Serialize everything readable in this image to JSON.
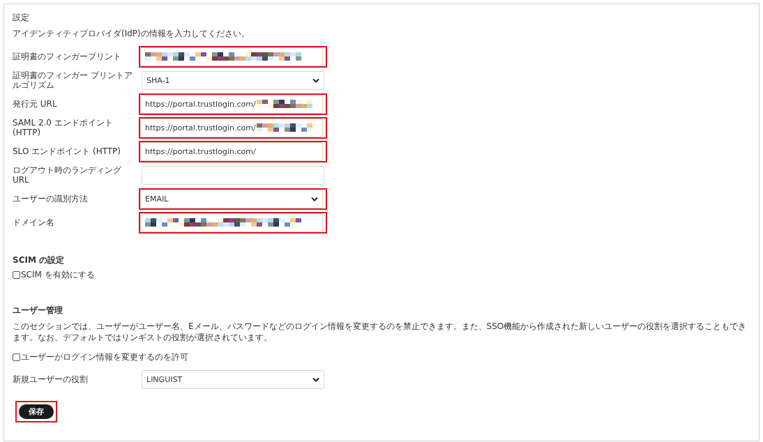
{
  "title": "設定",
  "intro": "アイデンティティプロバイダ(IdP)の情報を入力してください。",
  "fields": [
    {
      "label": "証明書のフィンガープリント",
      "kind": "text",
      "redacted": true,
      "highlighted": true
    },
    {
      "label": "証明書のフィンガー プリントアルゴリズム",
      "kind": "select",
      "value": "SHA-1",
      "redacted": false,
      "highlighted": false
    },
    {
      "label": "発行元 URL",
      "kind": "text",
      "value": "https://portal.trustlogin.com/",
      "redacted": true,
      "highlighted": true
    },
    {
      "label": "SAML 2.0 エンドポイント (HTTP)",
      "kind": "text",
      "value": "https://portal.trustlogin.com/",
      "redacted": true,
      "highlighted": true
    },
    {
      "label": "SLO エンドポイント (HTTP)",
      "kind": "text",
      "value": "https://portal.trustlogin.com/",
      "redacted": false,
      "highlighted": true
    },
    {
      "label": "ログアウト時のランディング URL",
      "kind": "text",
      "redacted": false,
      "highlighted": false
    },
    {
      "label": "ユーザーの識別方法",
      "kind": "select",
      "value": "EMAIL",
      "redacted": false,
      "highlighted": true
    },
    {
      "label": "ドメイン名",
      "kind": "text",
      "redacted": true,
      "highlighted": true
    }
  ],
  "scim": {
    "heading": "SCIM の設定",
    "checkbox": {
      "label": "SCIM を有効にする",
      "checked": false
    }
  },
  "user_management": {
    "heading": "ユーザー管理",
    "description": "このセクションでは、ユーザーがユーザー名、Eメール、パスワードなどのログイン情報を変更するのを禁止できます。また、SSO機能から作成された新しいユーザーの役割を選択することもできます。なお、デフォルトではリンギストの役割が選択されています。",
    "checkbox": {
      "label": "ユーザーがログイン情報を変更するのを許可",
      "checked": false
    },
    "role": {
      "label": "新規ユーザーの役割",
      "kind": "select",
      "value": "LINGUIST",
      "redacted": false,
      "highlighted": false
    }
  },
  "save_button": {
    "label": "保存",
    "highlighted": true
  }
}
